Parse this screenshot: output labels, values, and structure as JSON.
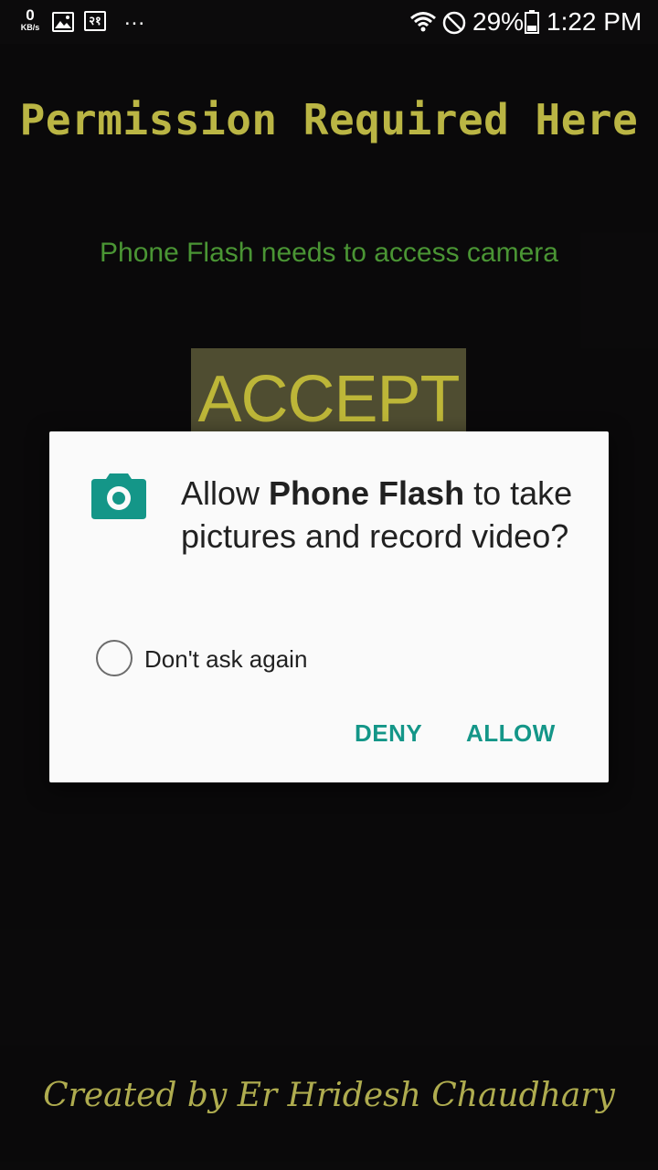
{
  "status_bar": {
    "net_speed_value": "0",
    "net_speed_unit": "KB/s",
    "gallery_icon": "image-icon",
    "rupee_icon_text": "२१",
    "more_icon": "...",
    "wifi_icon": "wifi-icon",
    "dnd_icon": "do-not-disturb-icon",
    "battery_percent": "29%",
    "battery_icon": "battery-icon",
    "time": "1:22 PM"
  },
  "app": {
    "title": "Permission Required Here",
    "subtitle": "Phone Flash needs to access camera",
    "accept_label": "ACCEPT",
    "credit": "Created by Er Hridesh Chaudhary"
  },
  "dialog": {
    "icon": "camera-icon",
    "message_prefix": "Allow ",
    "app_name": "Phone Flash",
    "message_suffix": " to take pictures and record video?",
    "checkbox_label": "Don't ask again",
    "deny_label": "DENY",
    "allow_label": "ALLOW"
  },
  "colors": {
    "background": "#0c0b0c",
    "title": "#d4cf4e",
    "subtitle": "#55aa3c",
    "accept_bg": "#5b5838",
    "accept_text": "#d8d040",
    "dialog_bg": "#fafafa",
    "dialog_accent": "#149688"
  }
}
